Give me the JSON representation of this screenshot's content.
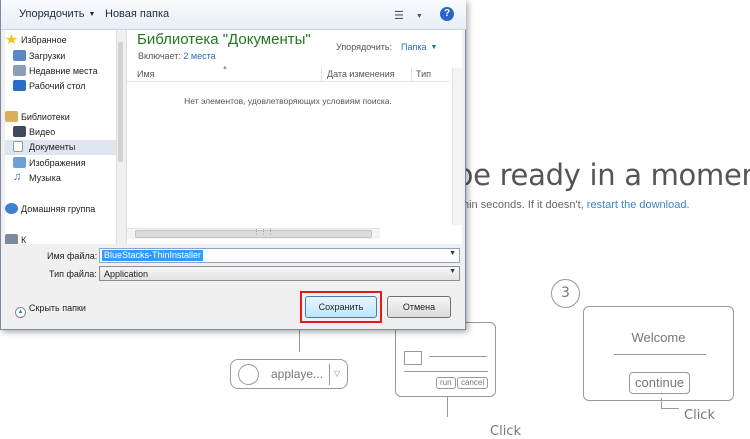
{
  "background": {
    "headline": "be ready in a moment!",
    "sub_text": "hin seconds. If it doesn't,",
    "sub_link": "restart the download.",
    "step_number": "3",
    "pill_text": "applaye...",
    "run_label": "run",
    "cancel_label": "cancel",
    "welcome_text": "Welcome",
    "continue_label": "continue",
    "click_left": "Click",
    "click_right": "Click"
  },
  "dialog": {
    "toolbar": {
      "organize_label": "Упорядочить",
      "new_folder_label": "Новая папка",
      "help_label": "?"
    },
    "nav": {
      "favorites": "Избранное",
      "downloads": "Загрузки",
      "recent": "Недавние места",
      "desktop": "Рабочий стол",
      "libraries": "Библиотеки",
      "video": "Видео",
      "documents": "Документы",
      "images": "Изображения",
      "music": "Музыка",
      "homegroup": "Домашняя группа",
      "computer": "К"
    },
    "library": {
      "title": "Библиотека \"Документы\"",
      "includes_label": "Включает:",
      "includes_link": "2 места",
      "arrange_label": "Упорядочить:",
      "arrange_value": "Папка"
    },
    "columns": {
      "name": "Имя",
      "date": "Дата изменения",
      "type": "Тип"
    },
    "empty_message": "Нет элементов, удовлетворяющих условиям поиска.",
    "filename_label": "Имя файла:",
    "filename_value": "BlueStacks-ThinInstaller",
    "filetype_label": "Тип файла:",
    "filetype_value": "Application",
    "hide_folders_label": "Скрыть папки",
    "save_label": "Сохранить",
    "cancel_label": "Отмена"
  },
  "colors": {
    "highlight_box": "#e01b1b",
    "library_title": "#1e7a1e",
    "link": "#3a87c8",
    "selection": "#3399ff"
  }
}
